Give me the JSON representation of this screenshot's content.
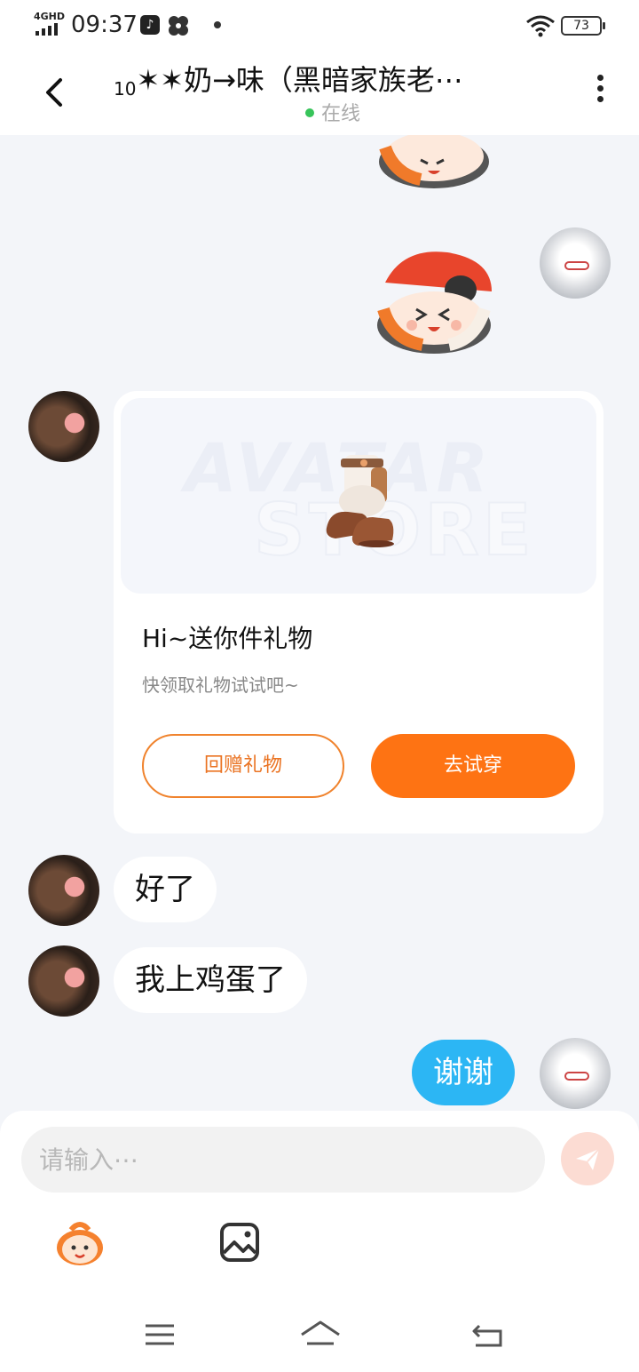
{
  "status_bar": {
    "network": "4GHD",
    "time": "09:37",
    "battery": "73"
  },
  "header": {
    "title_prefix": "10",
    "title": "✶✶奶→味（黑暗家族老⋯",
    "status": "在线"
  },
  "gift_card": {
    "watermark_top": "AVATAR",
    "watermark_bottom": "STORE",
    "title": "Hi~送你件礼物",
    "subtitle": "快领取礼物试试吧~",
    "return_gift_label": "回赠礼物",
    "try_on_label": "去试穿"
  },
  "messages": [
    {
      "from": "other",
      "text": "好了"
    },
    {
      "from": "other",
      "text": "我上鸡蛋了"
    },
    {
      "from": "self",
      "text": "谢谢"
    }
  ],
  "composer": {
    "placeholder": "请输入⋯"
  },
  "icons": {
    "back": "chevron-left-icon",
    "more": "more-vertical-icon",
    "send": "send-icon",
    "emoji": "emoji-icon",
    "image": "image-icon"
  },
  "colors": {
    "accent_orange": "#fe7313",
    "bubble_blue": "#2cb6f4",
    "online_green": "#37c45a"
  }
}
